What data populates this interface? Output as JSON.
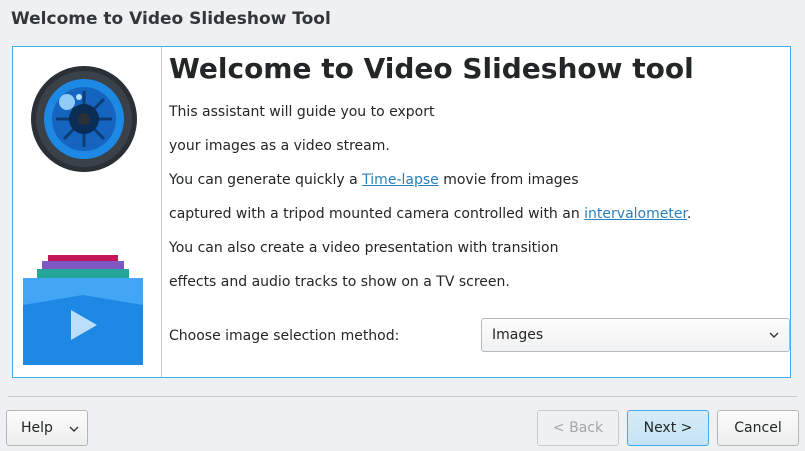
{
  "window": {
    "title": "Welcome to Video Slideshow Tool"
  },
  "page": {
    "heading": "Welcome to Video Slideshow tool",
    "line1": "This assistant will guide you to export",
    "line2": "your images as a video stream.",
    "line3_before": "You can generate quickly a ",
    "line3_link": "Time-lapse",
    "line3_after": " movie from images",
    "line4_before": "captured with a tripod mounted camera controlled with an ",
    "line4_link": "intervalometer",
    "line4_after": ".",
    "line5": "You can also create a video presentation with transition",
    "line6": "effects and audio tracks to show on a TV screen.",
    "select_label": "Choose image selection method:",
    "select_value": "Images"
  },
  "buttons": {
    "help": "Help",
    "back": "< Back",
    "next": "Next >",
    "cancel": "Cancel"
  },
  "icons": {
    "side_top": "camera-lens-icon",
    "side_bottom": "video-folder-icon",
    "dropdown": "chevron-down-icon"
  },
  "colors": {
    "accent": "#3daee9",
    "link": "#2980b9",
    "lens_blue": "#1e88e5"
  }
}
